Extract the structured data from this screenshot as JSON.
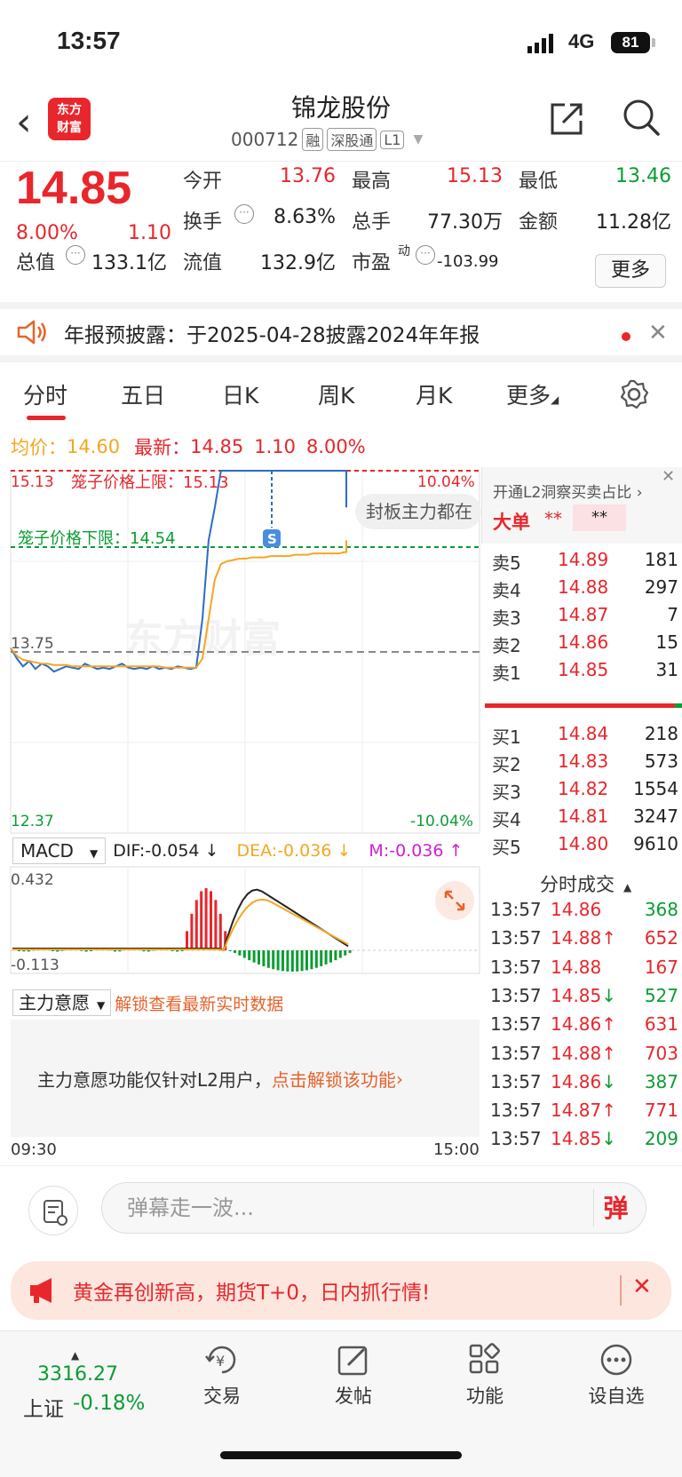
{
  "status": {
    "time": "13:57",
    "network": "4G",
    "battery": "81"
  },
  "header": {
    "logo_line1": "东方",
    "logo_line2": "财富",
    "name": "锦龙股份",
    "code": "000712",
    "tags": [
      "融",
      "深股通",
      "L1"
    ]
  },
  "quote": {
    "price": "14.85",
    "change_pct": "8.00%",
    "change": "1.10",
    "open_label": "今开",
    "open": "13.76",
    "high_label": "最高",
    "high": "15.13",
    "low_label": "最低",
    "low": "13.46",
    "turnover_label": "换手",
    "turnover": "8.63%",
    "volume_label": "总手",
    "volume": "77.30万",
    "amount_label": "金额",
    "amount": "11.28亿",
    "mcap_label": "总值",
    "mcap": "133.1亿",
    "float_label": "流值",
    "float": "132.9亿",
    "pe_label": "市盈",
    "pe_sup": "动",
    "pe": "-103.99",
    "more": "更多"
  },
  "notice": {
    "text": "年报预披露：于2025-04-28披露2024年年报"
  },
  "tabs": [
    "分时",
    "五日",
    "日K",
    "周K",
    "月K",
    "更多"
  ],
  "legend": {
    "avg_label": "均价：",
    "avg": "14.60",
    "latest_label": "最新：",
    "latest": "14.85",
    "change": "1.10",
    "pct": "8.00%"
  },
  "chart_data": {
    "type": "line",
    "y_top": "15.13",
    "y_base": "13.75",
    "y_bottom": "12.37",
    "pct_top": "10.04%",
    "pct_bottom": "-10.04%",
    "upper_limit_label": "笼子价格上限：15.13",
    "lower_limit_label": "笼子价格下限：14.54",
    "sealed_label": "封板主力都在",
    "watermark": "东方财富",
    "s_marker": "S",
    "x_start": "09:30",
    "x_end": "15:00",
    "ylim": [
      12.37,
      15.13
    ],
    "series": [
      {
        "name": "price",
        "color": "#2b6cc4",
        "values": [
          13.78,
          13.7,
          13.64,
          13.68,
          13.62,
          13.66,
          13.64,
          13.6,
          13.62,
          13.64,
          13.63,
          13.62,
          13.66,
          13.64,
          13.62,
          13.63,
          13.62,
          13.64,
          13.66,
          13.63,
          13.62,
          13.63,
          13.62,
          13.64,
          13.62,
          13.63,
          13.62,
          13.64,
          13.63,
          13.62,
          13.63,
          14.0,
          14.6,
          14.85,
          15.13,
          15.13,
          15.13,
          15.13,
          15.13,
          15.13,
          15.13,
          15.13,
          15.13,
          15.13,
          15.13,
          15.13,
          15.13,
          15.13,
          15.13,
          15.13,
          15.13,
          15.13,
          15.13,
          15.13,
          15.13,
          15.13,
          15.13,
          14.9,
          15.0,
          14.85
        ]
      },
      {
        "name": "avg",
        "color": "#f5a623",
        "values": [
          13.78,
          13.72,
          13.69,
          13.68,
          13.67,
          13.66,
          13.66,
          13.65,
          13.65,
          13.65,
          13.64,
          13.64,
          13.64,
          13.64,
          13.64,
          13.64,
          13.64,
          13.64,
          13.64,
          13.64,
          13.64,
          13.64,
          13.64,
          13.64,
          13.64,
          13.63,
          13.63,
          13.63,
          13.63,
          13.63,
          13.63,
          13.7,
          14.0,
          14.3,
          14.42,
          14.44,
          14.45,
          14.46,
          14.46,
          14.47,
          14.47,
          14.47,
          14.48,
          14.48,
          14.48,
          14.48,
          14.49,
          14.49,
          14.49,
          14.5,
          14.5,
          14.5,
          14.5,
          14.5,
          14.51,
          14.51,
          14.51,
          14.55,
          14.58,
          14.6
        ]
      }
    ]
  },
  "macd": {
    "select": "MACD",
    "dif": "DIF:-0.054 ↓",
    "dea": "DEA:-0.036 ↓",
    "m": "M:-0.036 ↑",
    "y_top": "0.432",
    "y_bottom": "-0.113"
  },
  "intent": {
    "select": "主力意愿",
    "unlock": "解锁查看最新实时数据",
    "msg": "主力意愿功能仅针对L2用户，",
    "msg_link": "点击解锁该功能"
  },
  "l2": {
    "title": "开通L2洞察买卖占比",
    "big_label": "大单",
    "big_a": "**",
    "big_b": "**",
    "asks": [
      {
        "label": "卖5",
        "price": "14.89",
        "vol": "181"
      },
      {
        "label": "卖4",
        "price": "14.88",
        "vol": "297"
      },
      {
        "label": "卖3",
        "price": "14.87",
        "vol": "7"
      },
      {
        "label": "卖2",
        "price": "14.86",
        "vol": "15"
      },
      {
        "label": "卖1",
        "price": "14.85",
        "vol": "31"
      }
    ],
    "bids": [
      {
        "label": "买1",
        "price": "14.84",
        "vol": "218"
      },
      {
        "label": "买2",
        "price": "14.83",
        "vol": "573"
      },
      {
        "label": "买3",
        "price": "14.82",
        "vol": "1554"
      },
      {
        "label": "买4",
        "price": "14.81",
        "vol": "3247"
      },
      {
        "label": "买5",
        "price": "14.80",
        "vol": "9610"
      }
    ],
    "trades_title": "分时成交",
    "trades": [
      {
        "time": "13:57",
        "price": "14.86",
        "arrow": "",
        "vol": "368",
        "dir": "red",
        "vdir": "green"
      },
      {
        "time": "13:57",
        "price": "14.88↑",
        "arrow": "",
        "vol": "652",
        "dir": "red",
        "vdir": "red"
      },
      {
        "time": "13:57",
        "price": "14.88",
        "arrow": "",
        "vol": "167",
        "dir": "red",
        "vdir": "red"
      },
      {
        "time": "13:57",
        "price": "14.85↓",
        "arrow": "",
        "vol": "527",
        "dir": "red",
        "vdir": "green"
      },
      {
        "time": "13:57",
        "price": "14.86↑",
        "arrow": "",
        "vol": "631",
        "dir": "red",
        "vdir": "red"
      },
      {
        "time": "13:57",
        "price": "14.88↑",
        "arrow": "",
        "vol": "703",
        "dir": "red",
        "vdir": "red"
      },
      {
        "time": "13:57",
        "price": "14.86↓",
        "arrow": "",
        "vol": "387",
        "dir": "red",
        "vdir": "green"
      },
      {
        "time": "13:57",
        "price": "14.87↑",
        "arrow": "",
        "vol": "771",
        "dir": "red",
        "vdir": "red"
      },
      {
        "time": "13:57",
        "price": "14.85↓",
        "arrow": "",
        "vol": "209",
        "dir": "red",
        "vdir": "green"
      }
    ]
  },
  "danmaku": {
    "placeholder": "弹幕走一波...",
    "send": "弹"
  },
  "ad": {
    "text": "黄金再创新高，期货T+0，日内抓行情!"
  },
  "nav": {
    "index_value": "3316.27",
    "index_name": "上证",
    "index_pct": "-0.18%",
    "items": [
      "交易",
      "发帖",
      "功能",
      "设自选"
    ]
  }
}
